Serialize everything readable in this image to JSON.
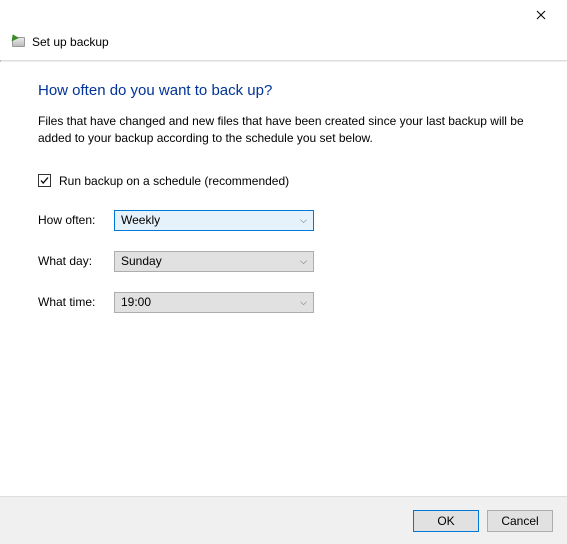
{
  "window": {
    "title": "Set up backup"
  },
  "page": {
    "heading": "How often do you want to back up?",
    "description": "Files that have changed and new files that have been created since your last backup will be added to your backup according to the schedule you set below."
  },
  "form": {
    "run_on_schedule": {
      "label": "Run backup on a schedule (recommended)",
      "checked": true
    },
    "how_often": {
      "label": "How often:",
      "value": "Weekly"
    },
    "what_day": {
      "label": "What day:",
      "value": "Sunday"
    },
    "what_time": {
      "label": "What time:",
      "value": "19:00"
    }
  },
  "footer": {
    "ok_label": "OK",
    "cancel_label": "Cancel"
  }
}
